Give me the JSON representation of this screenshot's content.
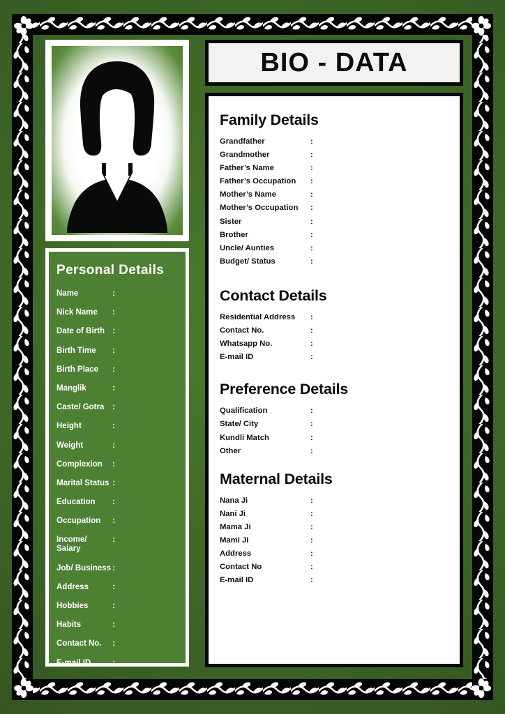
{
  "document": {
    "title": "BIO - DATA",
    "colors": {
      "background_green": "#3d6527",
      "panel_green": "#4e8034",
      "frame_black": "#050505",
      "paper_white": "#ffffff",
      "title_box": "#f2f2f0"
    }
  },
  "photo": {
    "placeholder_icon": "female-silhouette-avatar-icon"
  },
  "personal": {
    "title": "Personal Details",
    "colon": ":",
    "fields": [
      "Name",
      "Nick Name",
      "Date of Birth",
      "Birth Time",
      "Birth Place",
      "Manglik",
      "Caste/ Gotra",
      "Height",
      "Weight",
      "Complexion",
      "Marital Status",
      "Education",
      "Occupation",
      "Income/ Salary",
      "Job/ Business",
      "Address",
      "Hobbies",
      "Habits",
      "Contact No.",
      "E-mail ID"
    ]
  },
  "family": {
    "title": "Family Details",
    "colon": ":",
    "fields": [
      "Grandfather",
      "Grandmother",
      "Father’s Name",
      "Father’s Occupation",
      "Mother’s Name",
      "Mother’s Occupation",
      "Sister",
      "Brother",
      "Uncle/ Aunties",
      "Budget/ Status"
    ]
  },
  "contact": {
    "title": "Contact Details",
    "colon": ":",
    "fields": [
      "Residential Address",
      "Contact No.",
      "Whatsapp No.",
      "E-mail ID"
    ]
  },
  "preference": {
    "title": "Preference Details",
    "colon": ":",
    "fields": [
      "Qualification",
      "State/ City",
      "Kundli Match",
      "Other"
    ]
  },
  "maternal": {
    "title": "Maternal Details",
    "colon": ":",
    "fields": [
      "Nana Ji",
      "Nani Ji",
      "Mama Ji",
      "Mami Ji",
      "Address",
      "Contact No",
      "E-mail ID"
    ]
  }
}
